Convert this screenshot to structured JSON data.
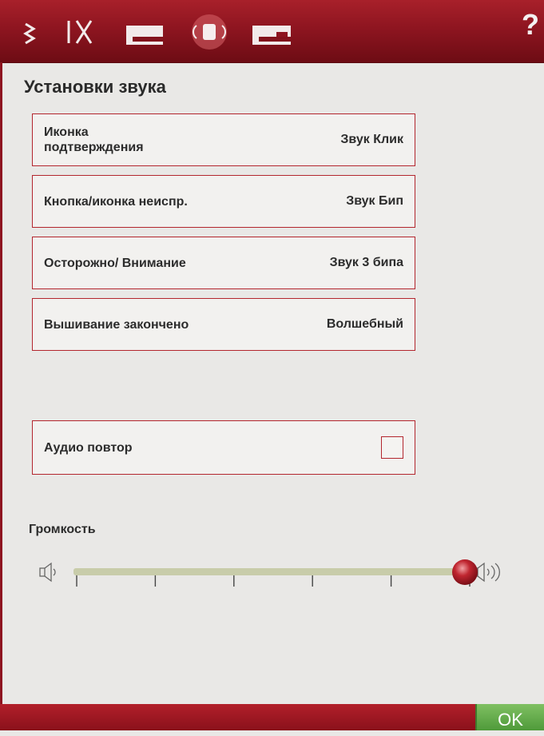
{
  "toolbar": {
    "tabs": [
      {
        "icon": "zigzag-stitch-icon"
      },
      {
        "icon": "needle-scissors-icon"
      },
      {
        "icon": "sewing-machine-icon"
      },
      {
        "icon": "sound-icon",
        "active": true
      },
      {
        "icon": "embroidery-machine-icon"
      }
    ],
    "help_label": "?"
  },
  "page": {
    "title": "Установки звука"
  },
  "settings": [
    {
      "label": "Иконка подтверждения",
      "value": "Звук Клик"
    },
    {
      "label": "Кнопка/иконка неиспр.",
      "value": "Звук Бип"
    },
    {
      "label": "Осторожно/ Внимание",
      "value": "Звук 3 бипа"
    },
    {
      "label": "Вышивание закончено",
      "value": "Волшебный"
    }
  ],
  "audio_repeat": {
    "label": "Аудио повтор",
    "checked": false
  },
  "volume": {
    "label": "Громкость",
    "level": 1.0,
    "ticks": 6
  },
  "footer": {
    "ok_label": "OK"
  },
  "colors": {
    "accent_red": "#b3262e",
    "topbar_red": "#8e1520",
    "ok_green": "#5aa843",
    "slider_track": "#c8ccaa"
  }
}
